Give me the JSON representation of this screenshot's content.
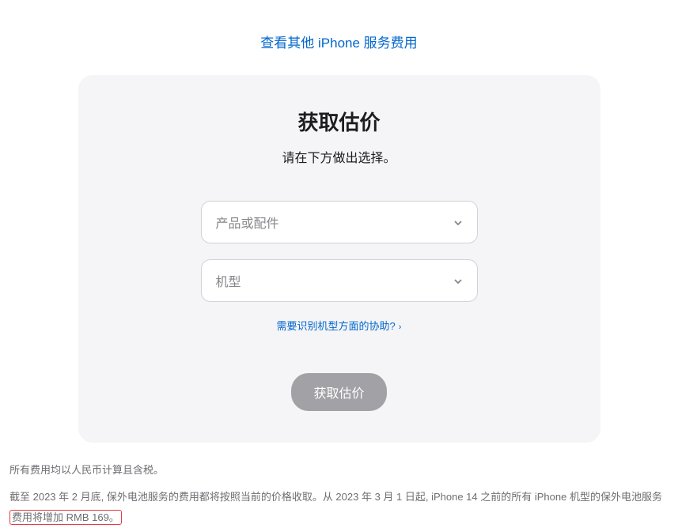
{
  "topLink": {
    "label": "查看其他 iPhone 服务费用"
  },
  "card": {
    "title": "获取估价",
    "subtitle": "请在下方做出选择。",
    "select1": {
      "placeholder": "产品或配件"
    },
    "select2": {
      "placeholder": "机型"
    },
    "helpLink": {
      "label": "需要识别机型方面的协助?"
    },
    "submitButton": {
      "label": "获取估价"
    }
  },
  "footer": {
    "line1": "所有费用均以人民币计算且含税。",
    "line2_part1": "截至 2023 年 2 月底, 保外电池服务的费用都将按照当前的价格收取。从 2023 年 3 月 1 日起, iPhone 14 之前的所有 iPhone 机型的保外电池服务",
    "line2_highlight": "费用将增加 RMB 169。"
  }
}
